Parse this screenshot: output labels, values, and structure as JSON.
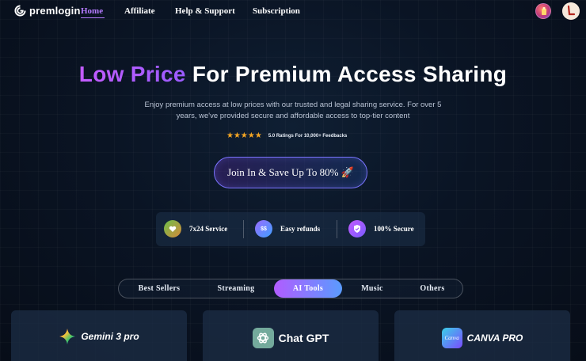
{
  "nav": {
    "logo_text": "premlogin",
    "links": [
      {
        "label": "Home",
        "active": true
      },
      {
        "label": "Affiliate"
      },
      {
        "label": "Help & Support"
      },
      {
        "label": "Subscription"
      }
    ],
    "avatar2_letter": "L"
  },
  "hero": {
    "title_accent": "Low Price",
    "title_rest": " For Premium Access Sharing",
    "subtitle": "Enjoy premium access at low prices with our trusted and legal sharing service. For over 5 years, we've provided secure and affordable access to top-tier content",
    "stars": "★★★★★",
    "rating_text": "5.0 Ratings For 10,000+ Feedbacks",
    "cta_label": "Join In & Save Up To 80% 🚀"
  },
  "features": [
    {
      "label": "7x24 Service",
      "icon": "heart-hands-icon"
    },
    {
      "label": "Easy refunds",
      "icon": "refund-icon",
      "icon_text": "$$"
    },
    {
      "label": "100% Secure",
      "icon": "shield-check-icon"
    }
  ],
  "tabs": [
    {
      "label": "Best Sellers"
    },
    {
      "label": "Streaming"
    },
    {
      "label": "AI Tools",
      "active": true
    },
    {
      "label": "Music"
    },
    {
      "label": "Others"
    }
  ],
  "cards": [
    {
      "label": "Gemini 3 pro",
      "icon": "gemini-icon"
    },
    {
      "label": "Chat GPT",
      "icon": "chatgpt-icon"
    },
    {
      "label": "CANVA PRO",
      "icon": "canva-icon",
      "icon_text": "Canva"
    }
  ],
  "colors": {
    "accent_purple": "#b57bff",
    "star": "#f6a623",
    "tab_gradient_start": "#b15cff",
    "tab_gradient_end": "#5a9bff"
  }
}
